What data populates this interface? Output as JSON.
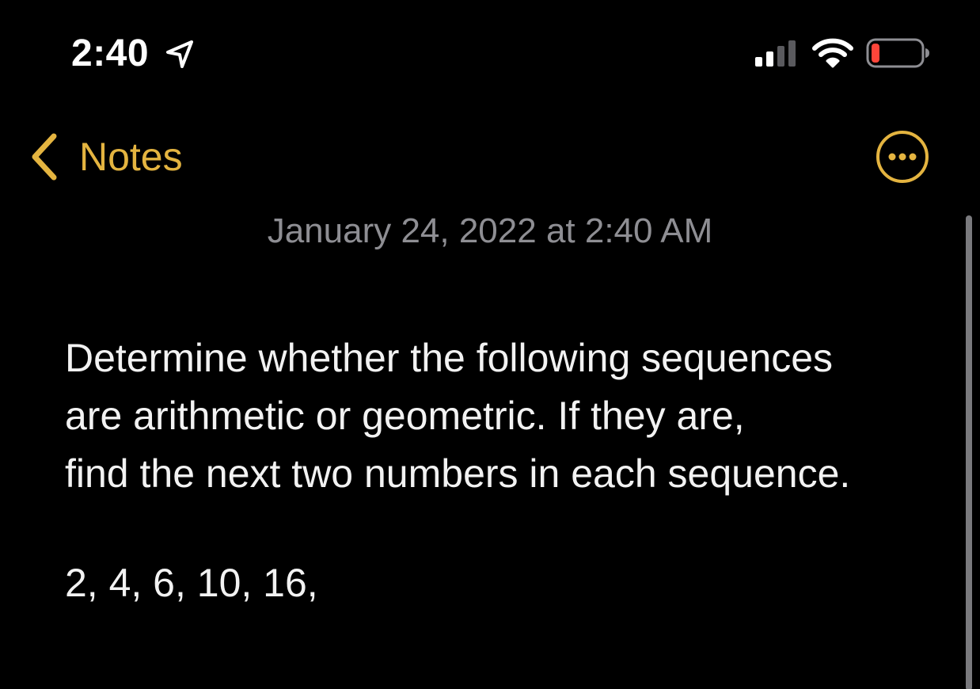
{
  "status_bar": {
    "time": "2:40",
    "location_icon": "location-arrow-icon",
    "signal_icon": "cellular-signal-icon",
    "wifi_icon": "wifi-icon",
    "battery_icon": "battery-low-icon"
  },
  "nav": {
    "back_label": "Notes",
    "back_icon": "chevron-left-icon",
    "more_icon": "ellipsis-circle-icon"
  },
  "note": {
    "date": "January 24, 2022 at 2:40 AM",
    "lines": [
      "Determine whether the following sequences",
      "are arithmetic or geometric. If they are,",
      "find the next two numbers in each sequence."
    ],
    "sequence": "2, 4, 6, 10, 16,"
  },
  "colors": {
    "accent": "#e4b440",
    "background": "#000000",
    "text": "#f2f2f2",
    "secondary_text": "#8e8e93",
    "battery_low": "#ff453a"
  }
}
